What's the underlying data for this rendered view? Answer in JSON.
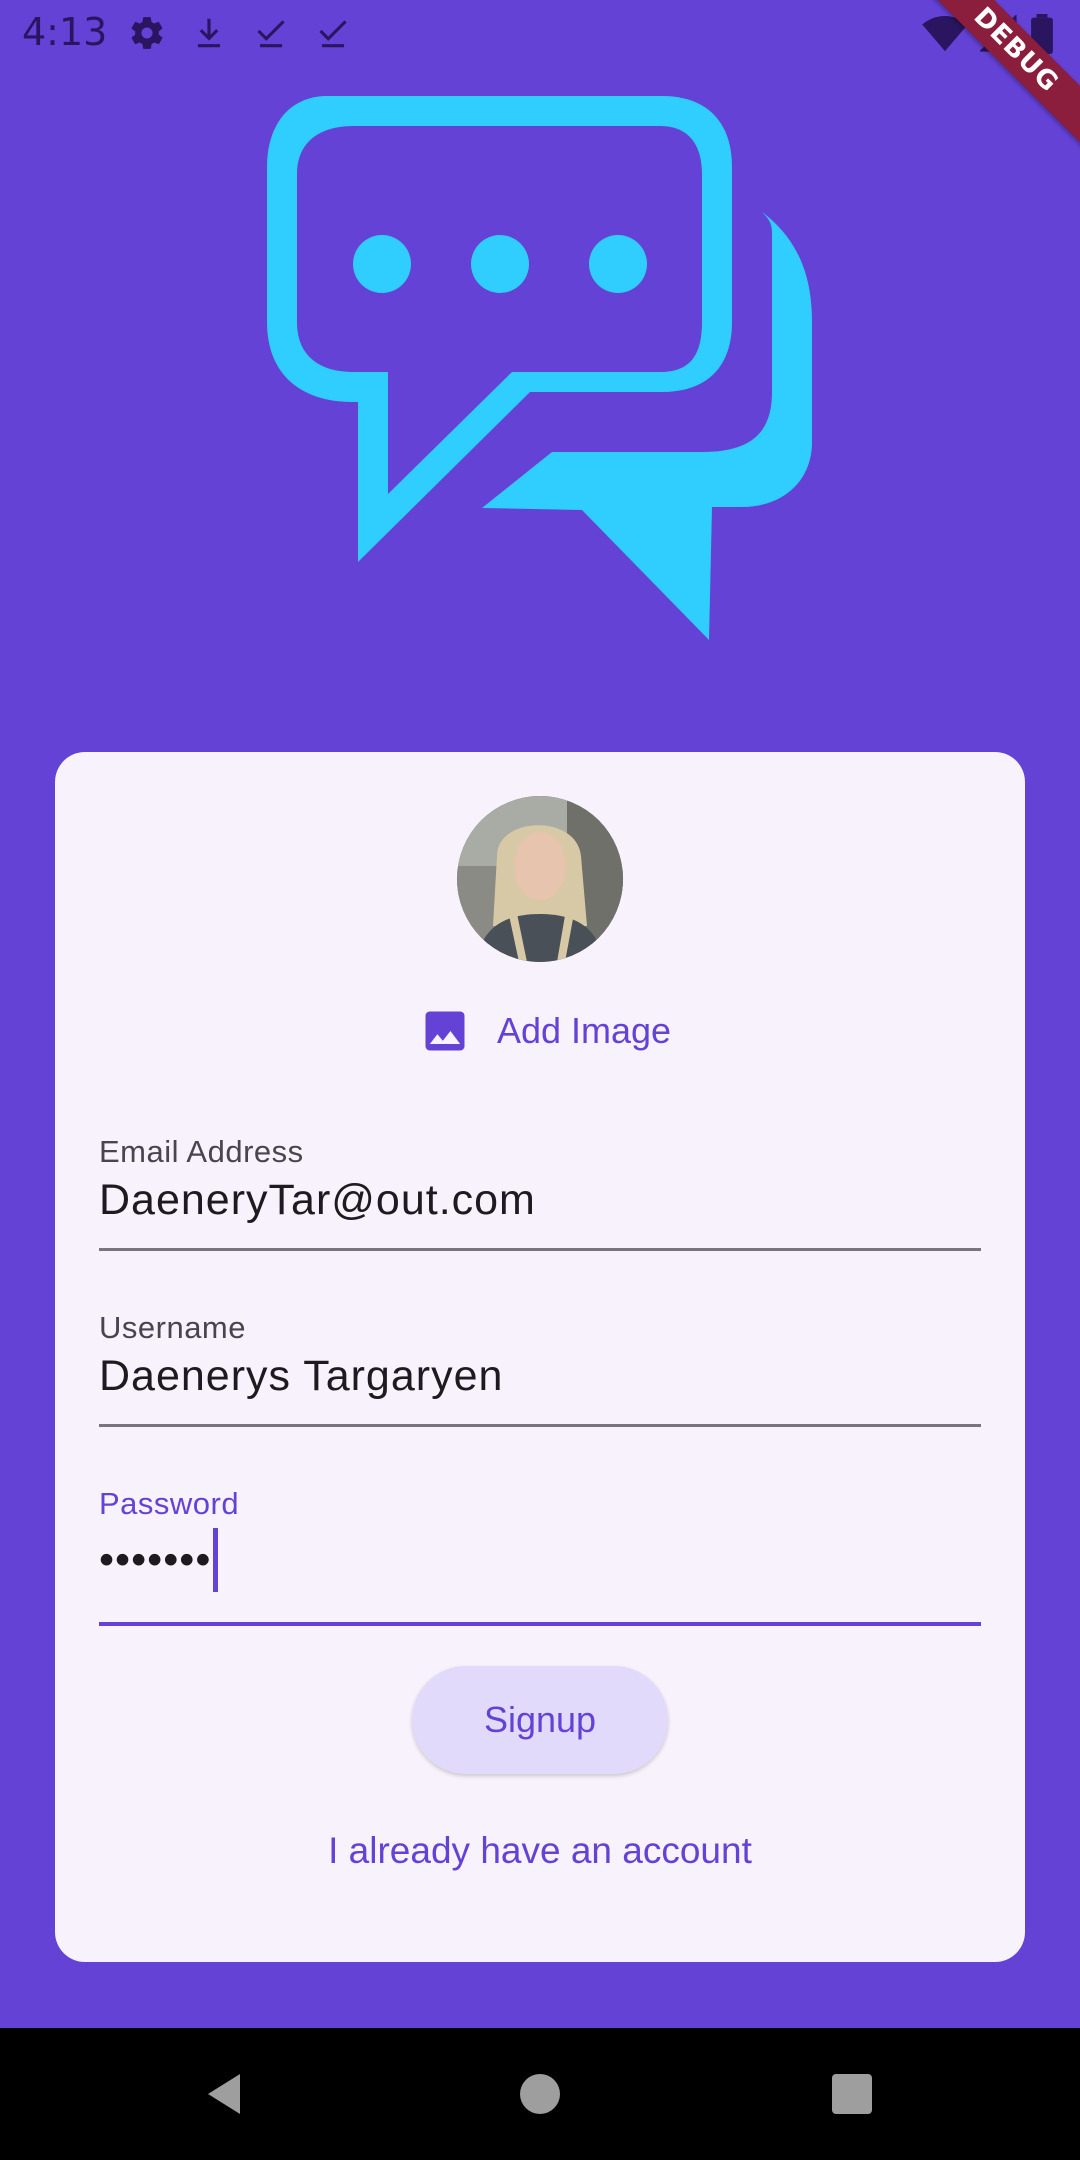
{
  "status_bar": {
    "time": "4:13",
    "left_icons": [
      "settings-icon",
      "download-icon",
      "check-download-icon",
      "check-download-icon"
    ],
    "right_icons": [
      "wifi-icon",
      "signal-icon",
      "battery-icon"
    ]
  },
  "debug_banner": "DEBUG",
  "colors": {
    "background": "#6442d6",
    "logo": "#30cdff",
    "card": "#f7f2fb",
    "accent": "#6442d6",
    "button_bg": "#e2dafb"
  },
  "form": {
    "add_image_label": "Add Image",
    "email": {
      "label": "Email Address",
      "value": "DaeneryTar@out.com"
    },
    "username": {
      "label": "Username",
      "value": "Daenerys Targaryen"
    },
    "password": {
      "label": "Password",
      "value": "•••••••"
    },
    "signup_label": "Signup",
    "login_link": "I already have an account"
  },
  "nav": [
    "back-icon",
    "home-icon",
    "recents-icon"
  ]
}
